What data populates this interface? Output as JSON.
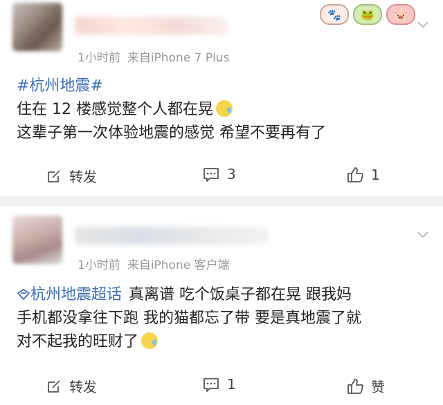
{
  "posts": [
    {
      "meta_time": "1小时前",
      "meta_source": "来自iPhone 7 Plus",
      "content_tag": "#杭州地震#",
      "content_lines": [
        "住在 12 楼感觉整个人都在晃",
        "这辈子第一次体验地震的感觉 希望不要再有了"
      ],
      "actions": {
        "repost": "转发",
        "comments": "3",
        "likes": "1"
      }
    },
    {
      "meta_time": "1小时前",
      "meta_source": "来自iPhone 客户端",
      "content_tag": "杭州地震超话",
      "content_lines": [
        "真离谱 吃个饭桌子都在晃 跟我妈",
        "手机都没拿往下跑 我的猫都忘了带 要是真地震了就",
        "对不起我的旺财了"
      ],
      "actions": {
        "repost": "转发",
        "comments": "1",
        "likes": "赞"
      }
    }
  ],
  "colors": {
    "link": "#3d6fb5",
    "meta": "#999999",
    "separator": "#f2f2f2"
  }
}
